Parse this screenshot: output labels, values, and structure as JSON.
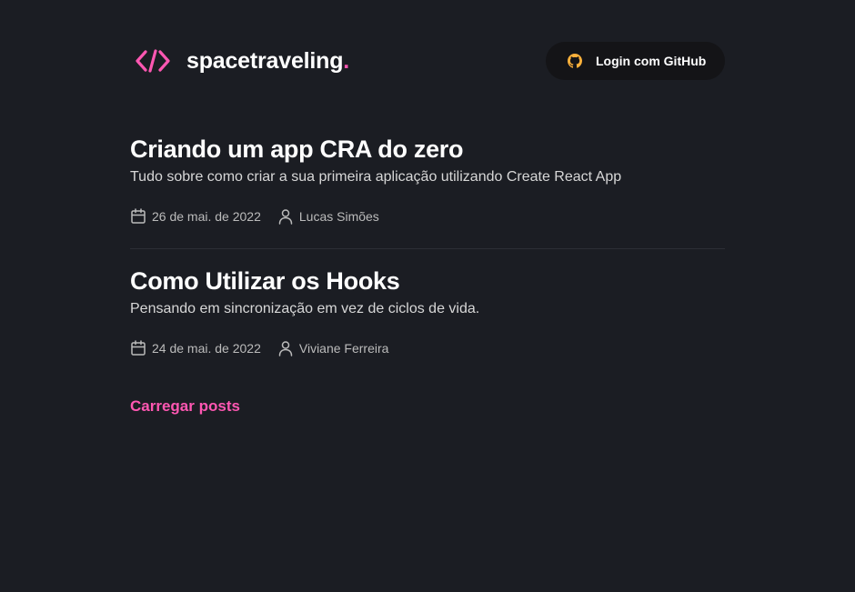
{
  "header": {
    "logo_text": "spacetraveling",
    "logo_dot": ".",
    "login_label": "Login com GitHub",
    "logo_icon": "code-brackets-icon",
    "login_icon": "github-icon"
  },
  "posts": [
    {
      "title": "Criando um app CRA do zero",
      "subtitle": "Tudo sobre como criar a sua primeira aplicação utilizando Create React App",
      "date": "26 de mai. de 2022",
      "author": "Lucas Simões"
    },
    {
      "title": "Como Utilizar os Hooks",
      "subtitle": "Pensando em sincronização em vez de ciclos de vida.",
      "date": "24 de mai. de 2022",
      "author": "Viviane Ferreira"
    }
  ],
  "load_more_label": "Carregar posts",
  "colors": {
    "background": "#1b1d23",
    "accent": "#ff57b2",
    "github_icon": "#ffb13b",
    "button_bg": "#141417"
  }
}
